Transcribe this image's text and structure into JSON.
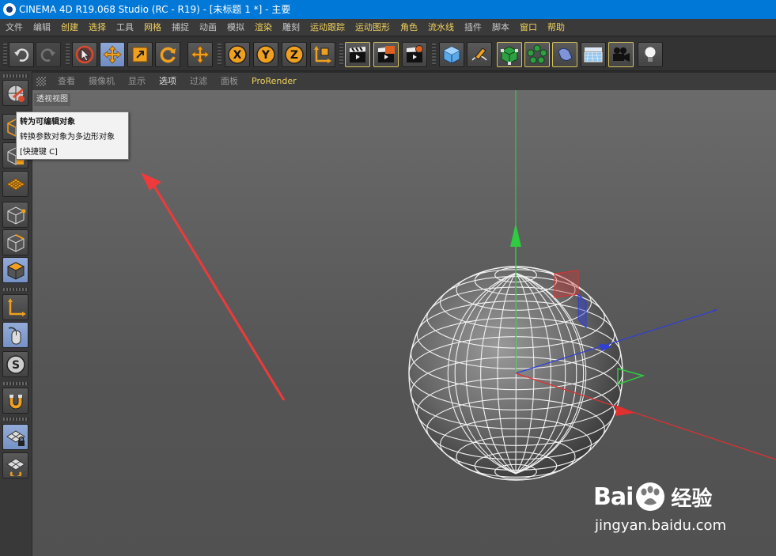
{
  "window": {
    "title": "CINEMA 4D R19.068 Studio (RC - R19) - [未标题 1 *] - 主要"
  },
  "menu": {
    "items": [
      {
        "label": "文件",
        "highlight": false
      },
      {
        "label": "编辑",
        "highlight": false
      },
      {
        "label": "创建",
        "highlight": true
      },
      {
        "label": "选择",
        "highlight": true
      },
      {
        "label": "工具",
        "highlight": false
      },
      {
        "label": "网格",
        "highlight": true
      },
      {
        "label": "捕捉",
        "highlight": false
      },
      {
        "label": "动画",
        "highlight": false
      },
      {
        "label": "模拟",
        "highlight": false
      },
      {
        "label": "渲染",
        "highlight": true
      },
      {
        "label": "雕刻",
        "highlight": false
      },
      {
        "label": "运动跟踪",
        "highlight": true
      },
      {
        "label": "运动图形",
        "highlight": true
      },
      {
        "label": "角色",
        "highlight": true
      },
      {
        "label": "流水线",
        "highlight": true
      },
      {
        "label": "插件",
        "highlight": false
      },
      {
        "label": "脚本",
        "highlight": false
      },
      {
        "label": "窗口",
        "highlight": true
      },
      {
        "label": "帮助",
        "highlight": true
      }
    ]
  },
  "toolbar": {
    "axis_x": "X",
    "axis_y": "Y",
    "axis_z": "Z"
  },
  "viewport_menu": {
    "items": [
      {
        "label": "查看",
        "state": "normal"
      },
      {
        "label": "摄像机",
        "state": "normal"
      },
      {
        "label": "显示",
        "state": "normal"
      },
      {
        "label": "选项",
        "state": "on"
      },
      {
        "label": "过滤",
        "state": "normal"
      },
      {
        "label": "面板",
        "state": "normal"
      },
      {
        "label": "ProRender",
        "state": "pro"
      }
    ]
  },
  "viewport": {
    "label": "透视视图",
    "background": "#626262",
    "sphere_color": "#6a6a6a",
    "axis_colors": {
      "x": "#e03030",
      "y": "#2ecc40",
      "z": "#2f3fd8"
    }
  },
  "tooltip": {
    "title": "转为可编辑对象",
    "description": "转换参数对象为多边形对象",
    "shortcut": "[快捷键 C]"
  },
  "watermark": {
    "brand": "Baidu经验",
    "url": "jingyan.baidu.com"
  }
}
